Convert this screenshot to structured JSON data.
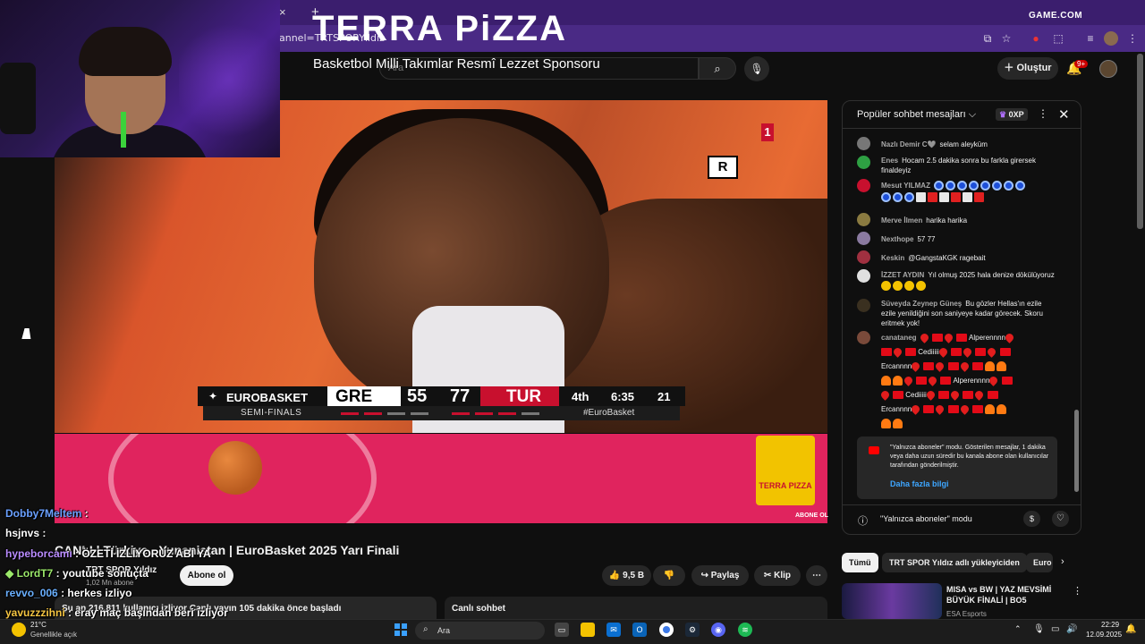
{
  "browser": {
    "url": "annel=TRTSPORYıldız",
    "tab_close": "×",
    "tab_new": "+",
    "watermark": "GAME.COM"
  },
  "yt_header": {
    "search_placeholder": "Ara",
    "create_label": "Oluştur",
    "notification_count": "9+"
  },
  "video": {
    "channel_logo": "1",
    "rating_badge": "R",
    "scoreboard": {
      "league": "EUROBASKET",
      "round": "SEMI-FINALS",
      "team1": "GRE",
      "score1": "55",
      "score2": "77",
      "team2": "TUR",
      "quarter": "4th",
      "clock": "6:35",
      "shot_clock": "21",
      "hashtag": "#EuroBasket"
    }
  },
  "banner": {
    "title": "TERRA PiZZA",
    "subtitle": "Basketbol Milli Takımlar Resmî Lezzet Sponsoru",
    "logo_text": "TERRA PIZZA",
    "subscribe_small": "ABONE OL"
  },
  "below_video": {
    "title": "CANLI | Türkiye - Yunanistan | EuroBasket 2025 Yarı Finali",
    "channel_name": "TRT SPOR Yıldız",
    "subscribers": "1,02 Mn abone",
    "subscribe_button": "Abone ol",
    "likes": "9,5 B",
    "share": "Paylaş",
    "clip": "Klip",
    "more": "⋯",
    "description": "Şu an 216.811 kullanıcı izliyor  Canlı yayın 105 dakika önce başladı",
    "live_chat": "Canlı sohbet"
  },
  "overlay_chat": [
    {
      "user": "Dobby7Meltem",
      "text": ":"
    },
    {
      "user": "hsjnvs",
      "text": ":"
    },
    {
      "user": "hypeborcamı",
      "text": ": ÖZETİ İZLİYORUZ ABİ YA"
    },
    {
      "user": "LordT7",
      "text": ": youtube sonuçta"
    },
    {
      "user": "revvo_006",
      "text": ": herkes izliyo"
    },
    {
      "user": "yavuzzzihni",
      "text": ": eray maç başından beri izliyor"
    }
  ],
  "overlay_colors": {
    "dobby": "#6aa0ff",
    "hsjnvs": "#ffffff",
    "hypeborcami": "#b98cff",
    "lordt7": "#9be86a",
    "revvo": "#6ab0ff",
    "yavuz": "#f5c542"
  },
  "chat": {
    "header_title": "Popüler sohbet mesajları ⌵",
    "xp": "0XP",
    "more": "⋮",
    "close": "✕",
    "messages": [
      {
        "author": "Nazlı Demir C🩶",
        "text": "selam aleyküm"
      },
      {
        "author": "Enes",
        "text": "Hocam 2.5 dakika sonra bu farkla girersek finaldeyiz"
      },
      {
        "author": "Mesut YILMAZ",
        "text": ""
      },
      {
        "author": "Merve İlmen",
        "text": "harika harika"
      },
      {
        "author": "Nexthope",
        "text": "57 77"
      },
      {
        "author": "Keskin",
        "text": "@GangstaKGK ragebait"
      },
      {
        "author": "İZZET AYDIN",
        "text": "Yıl olmuş 2025 hala denize dökülüyoruz"
      },
      {
        "author": "Süveyda Zeynep Güneş",
        "text": "Bu gözler Hellas'ın ezile ezile yenildiğini son saniyeye kadar görecek. Skoru eritmek yok!"
      },
      {
        "author": "canataneg",
        "text": ""
      }
    ],
    "canataneg_words": {
      "w1": "Alperennnn",
      "w2": "Cediiiii",
      "w3": "Ercannnn",
      "w4": "Alperennnn",
      "w5": "Cediiiii",
      "w6": "Ercannnn"
    },
    "notice": "\"Yalnızca aboneler\" modu. Gösterilen mesajlar, 1 dakika veya daha uzun süredir bu kanala abone olan kullanıcılar tarafından gönderilmiştir.",
    "notice_link": "Daha fazla bilgi",
    "footer_text": "\"Yalnızca aboneler\" modu",
    "footer_dollar": "$"
  },
  "related": {
    "chips": [
      "Tümü",
      "TRT SPOR Yıldız adlı yükleyiciden",
      "Euro"
    ],
    "title": "MISA vs BW | YAZ MEVSİMİ BÜYÜK FİNALİ | BO5",
    "channel": "ESA Esports"
  },
  "taskbar": {
    "weather_temp": "21°C",
    "weather_desc": "Genellikle açık",
    "search": "Ara",
    "time": "22:29",
    "date": "12.09.2025"
  }
}
